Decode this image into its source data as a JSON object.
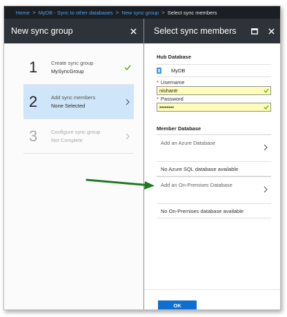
{
  "breadcrumb": {
    "items": [
      {
        "label": "Home",
        "link": true
      },
      {
        "label": "MyDB - Sync to other databases",
        "link": true
      },
      {
        "label": "New sync group",
        "link": true
      },
      {
        "label": "Select sync members",
        "link": false
      }
    ],
    "separator": ">"
  },
  "left_blade": {
    "title": "New sync group",
    "close_icon": "close-icon",
    "steps": [
      {
        "number": "1",
        "title": "Create sync group",
        "subtitle": "MySyncGroup",
        "status": "complete",
        "trail_icon": "checkmark-icon"
      },
      {
        "number": "2",
        "title": "Add sync members",
        "subtitle": "None Selected",
        "status": "active",
        "trail_icon": "chevron-right-icon"
      },
      {
        "number": "3",
        "title": "Configure sync group",
        "subtitle": "Not Complete",
        "status": "disabled",
        "trail_icon": "chevron-right-icon"
      }
    ]
  },
  "right_blade": {
    "title": "Select sync members",
    "maximize_icon": "maximize-icon",
    "close_icon": "close-icon",
    "hub": {
      "section_title": "Hub Database",
      "db_icon": "database-icon",
      "db_name": "MyDB",
      "username_label": "Username",
      "username_value": "nishantr",
      "password_label": "Password",
      "password_value": "••••••••",
      "required_mark": "*"
    },
    "member": {
      "section_title": "Member Database",
      "add_azure_label": "Add an Azure Database",
      "azure_status": "No Azure SQL database available",
      "add_onprem_label": "Add an On-Premises Database",
      "onprem_status": "No On-Premises database available"
    },
    "ok_label": "OK"
  },
  "colors": {
    "header_bg": "#2d3338",
    "breadcrumb_bg": "#1b1f24",
    "link": "#4aa3f0",
    "active_step_bg": "#cfe6fa",
    "ok_button": "#0e6fd0",
    "field_bg": "#fdfdb8",
    "check_green": "#5fa70f",
    "annotation_arrow": "#1e7a1e"
  }
}
